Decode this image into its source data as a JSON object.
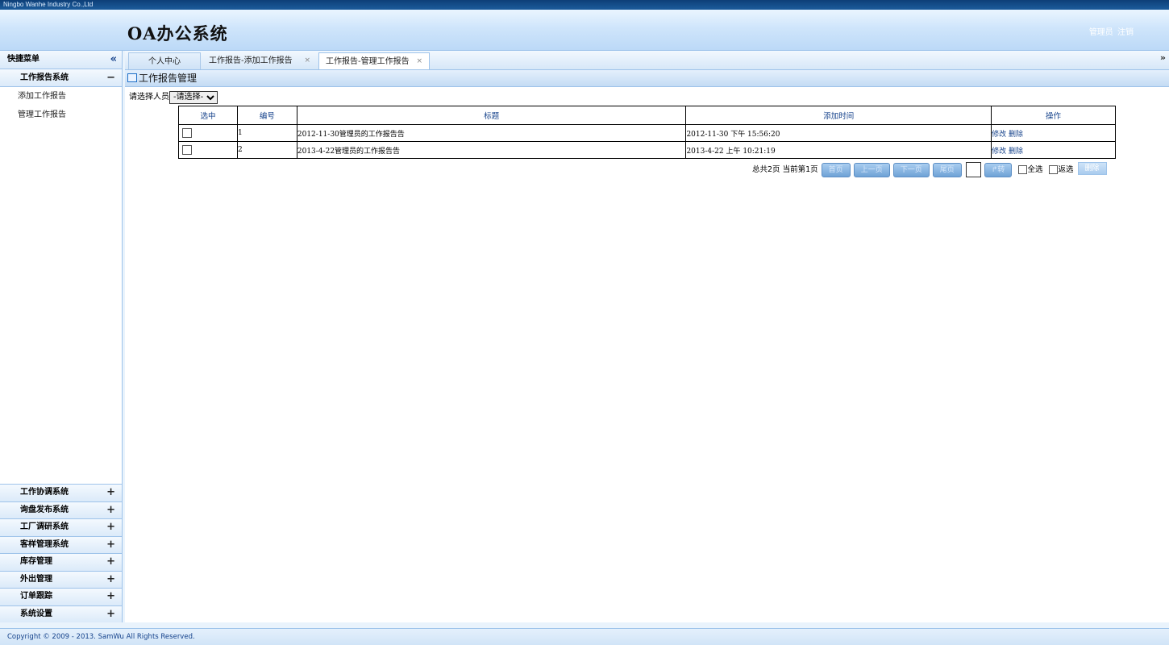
{
  "company": "Ningbo Wanhe Industry Co.,Ltd",
  "app_title": "OA办公系统",
  "user": {
    "name": "管理员",
    "logout": "注销"
  },
  "sidebar": {
    "header": "快捷菜单",
    "collapse_icon": "«",
    "open_group": {
      "label": "工作报告系统",
      "sign": "−"
    },
    "items": [
      {
        "label": "添加工作报告"
      },
      {
        "label": "管理工作报告"
      }
    ],
    "groups": [
      {
        "label": "工作协调系统",
        "sign": "+"
      },
      {
        "label": "询盘发布系统",
        "sign": "+"
      },
      {
        "label": "工厂调研系统",
        "sign": "+"
      },
      {
        "label": "客样管理系统",
        "sign": "+"
      },
      {
        "label": "库存管理",
        "sign": "+"
      },
      {
        "label": "外出管理",
        "sign": "+"
      },
      {
        "label": "订单跟踪",
        "sign": "+"
      },
      {
        "label": "系统设置",
        "sign": "+"
      }
    ]
  },
  "tabs": [
    {
      "label": "个人中心"
    },
    {
      "label": "工作报告-添加工作报告",
      "close": "×"
    },
    {
      "label": "工作报告-管理工作报告",
      "close": "×"
    }
  ],
  "tab_scroll_icon": "»",
  "panel_title": "工作报告管理",
  "filter": {
    "label": "请选择人员",
    "selected": "-请选择-"
  },
  "table": {
    "headers": [
      "选中",
      "编号",
      "标题",
      "添加时间",
      "操作"
    ],
    "rows": [
      {
        "id": "1",
        "title": "2012-11-30管理员的工作报告告",
        "time": "2012-11-30 下午 15:56:20",
        "edit": "修改",
        "delete": "删除"
      },
      {
        "id": "2",
        "title": "2013-4-22管理员的工作报告告",
        "time": "2013-4-22 上午 10:21:19",
        "edit": "修改",
        "delete": "删除"
      }
    ]
  },
  "pager": {
    "summary": "总共2页 当前第1页",
    "first": "首页",
    "prev": "上一页",
    "next": "下一页",
    "last": "尾页",
    "go": "↱转",
    "select_all": "全选",
    "invert": "返选",
    "delete": "删除"
  },
  "footer": "Copyright © 2009 - 2013. SamWu All Rights Reserved."
}
